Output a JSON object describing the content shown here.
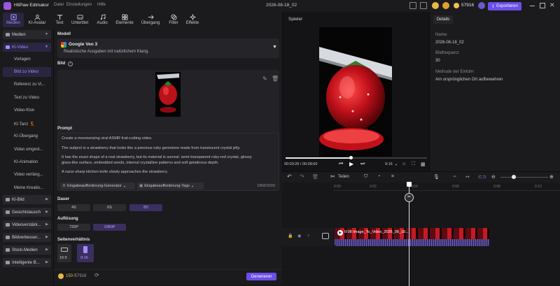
{
  "app": {
    "name": "HitPaw Edimakor",
    "menu": [
      "Datei",
      "Einstellungen",
      "Hilfe"
    ],
    "project": "2026-08-18_02",
    "credits": "57916",
    "export_label": "Exportieren"
  },
  "toolbar": {
    "tabs": [
      {
        "label": "Medien",
        "icon": "media-icon"
      },
      {
        "label": "KI-Avatar",
        "icon": "avatar-icon"
      },
      {
        "label": "Text",
        "icon": "text-icon"
      },
      {
        "label": "Untertitel",
        "icon": "subtitle-icon"
      },
      {
        "label": "Audio",
        "icon": "audio-icon"
      },
      {
        "label": "Elemente",
        "icon": "elements-icon"
      },
      {
        "label": "Übergang",
        "icon": "transition-icon"
      },
      {
        "label": "Filter",
        "icon": "filter-icon"
      },
      {
        "label": "Effekte",
        "icon": "effects-icon"
      }
    ]
  },
  "leftnav": {
    "medien": "Medien",
    "ki_video": "KI-Video",
    "ki_video_items": [
      "Vorlagen",
      "Bild zu Video",
      "Referenz zu Vi...",
      "Text zu Video",
      "Video-Klon",
      "KI-Tanz 💃",
      "KI-Übergang",
      "Video umgest...",
      "KI-Animation",
      "Video verläng...",
      "Meine Kreatio..."
    ],
    "groups": [
      "KI-Bild",
      "Gesichtstausch",
      "Videoverstärk...",
      "Bildverbesser...",
      "Stock-Medien",
      "Intelligente B..."
    ]
  },
  "settings": {
    "model_label": "Modell",
    "model_name": "Google Veo 3",
    "model_desc": "Realistische Ausgaben mit natürlichem Klang.",
    "image_label": "Bild",
    "prompt_label": "Prompt",
    "prompt_lines": [
      "Create a mesmerizing viral ASMR fruit-cutting video.",
      "The subject is a strawberry that looks like a precious ruby gemstone made from translucent crystal jelly.",
      "It has the exact shape of a real strawberry, but its material is surreal: semi-transparent ruby-red crystal, glossy",
      "glass-like surface, embedded seeds, internal crystalline patterns and soft gelatinous depth.",
      "A razor-sharp kitchen knife slowly approaches the strawberry."
    ],
    "prompt_generator": "Eingabeaufforderung-Generator",
    "prompt_tags": "Eingabeaufforderung-Tags",
    "char_count": "1868/2000",
    "duration_label": "Dauer",
    "durations": [
      "4S",
      "6S",
      "8S"
    ],
    "resolution_label": "Auflösung",
    "resolutions": [
      "720P",
      "1080P"
    ],
    "aspect_label": "Seitenverhältnis",
    "aspects": [
      "16:9",
      "9:16"
    ],
    "cost": "150",
    "credits_total": "/57916",
    "generate_label": "Generieren"
  },
  "preview": {
    "label": "Spieler",
    "time": "00:03:26 / 00:08:00",
    "ratio": "9:16",
    "progress": 0.46
  },
  "details": {
    "tab": "Details",
    "name_key": "Name:",
    "name_val": "2026-08-18_02",
    "fps_key": "Bildfrequenz:",
    "fps_val": "30",
    "method_key": "Methode der Einfuhr:",
    "method_val": "Am ursprünglichen Ort aufbewahren"
  },
  "timeline": {
    "split_label": "Teilen",
    "ticks": [
      "0:00",
      "0:02",
      "0:04",
      "0:06",
      "0:08",
      "0:10"
    ],
    "clip_name": "0:08  Image_To_Video_2026_08_18..."
  },
  "colors": {
    "accent": "#7b5cf0",
    "accent_soft": "#a68bff",
    "bg": "#141416",
    "panel": "#1b1b1e"
  }
}
